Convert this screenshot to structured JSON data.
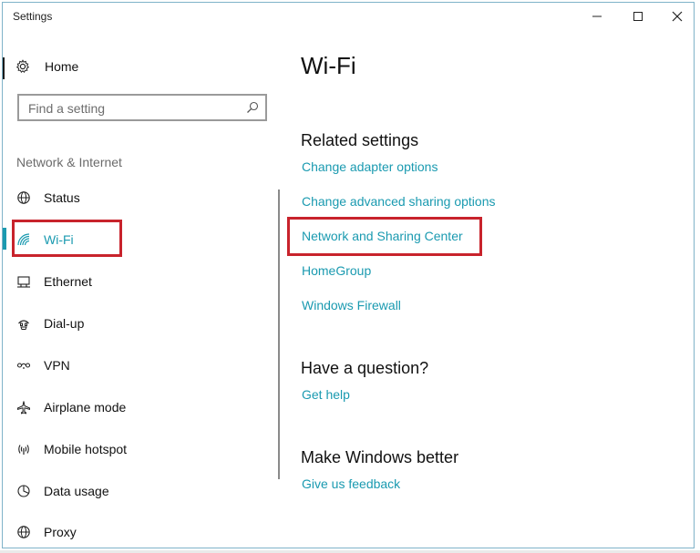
{
  "window": {
    "title": "Settings"
  },
  "sidebar": {
    "home_label": "Home",
    "search_placeholder": "Find a setting",
    "section_label": "Network & Internet",
    "items": [
      {
        "label": "Status",
        "icon": "globe-icon"
      },
      {
        "label": "Wi-Fi",
        "icon": "wifi-icon",
        "selected": true
      },
      {
        "label": "Ethernet",
        "icon": "ethernet-icon"
      },
      {
        "label": "Dial-up",
        "icon": "dialup-icon"
      },
      {
        "label": "VPN",
        "icon": "vpn-icon"
      },
      {
        "label": "Airplane mode",
        "icon": "airplane-icon"
      },
      {
        "label": "Mobile hotspot",
        "icon": "hotspot-icon"
      },
      {
        "label": "Data usage",
        "icon": "data-usage-icon"
      },
      {
        "label": "Proxy",
        "icon": "globe-icon"
      }
    ]
  },
  "main": {
    "title": "Wi-Fi",
    "related": {
      "heading": "Related settings",
      "links": [
        "Change adapter options",
        "Change advanced sharing options",
        "Network and Sharing Center",
        "HomeGroup",
        "Windows Firewall"
      ]
    },
    "question": {
      "heading": "Have a question?",
      "link": "Get help"
    },
    "better": {
      "heading": "Make Windows better",
      "link": "Give us feedback"
    }
  },
  "colors": {
    "accent": "#1a9ab0",
    "highlight_box": "#c8232c",
    "window_border": "#7fb3c9"
  }
}
